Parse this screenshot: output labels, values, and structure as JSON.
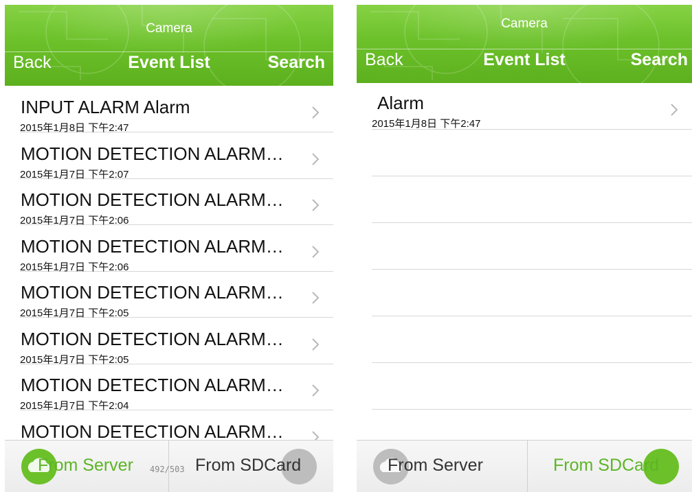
{
  "left": {
    "header": {
      "app_title": "Camera",
      "back_label": "Back",
      "title": "Event List",
      "search_label": "Search"
    },
    "events": [
      {
        "title": "INPUT ALARM Alarm",
        "date": "2015年1月8日 下午2:47"
      },
      {
        "title": "MOTION DETECTION ALARM…",
        "date": "2015年1月7日 下午2:07"
      },
      {
        "title": "MOTION DETECTION ALARM…",
        "date": "2015年1月7日 下午2:06"
      },
      {
        "title": "MOTION DETECTION ALARM…",
        "date": "2015年1月7日 下午2:06"
      },
      {
        "title": "MOTION DETECTION ALARM…",
        "date": "2015年1月7日 下午2:05"
      },
      {
        "title": "MOTION DETECTION ALARM…",
        "date": "2015年1月7日 下午2:05"
      },
      {
        "title": "MOTION DETECTION ALARM…",
        "date": "2015年1月7日 下午2:04"
      },
      {
        "title": "MOTION DETECTION ALARM…",
        "date": ""
      }
    ],
    "tabs": {
      "server_label": "From Server",
      "sdcard_label": "From SDCard",
      "active": "server"
    },
    "page_counter": "492/503"
  },
  "right": {
    "header": {
      "app_title": "Camera",
      "back_label": "Back",
      "title": "Event List",
      "search_label": "Search"
    },
    "events": [
      {
        "title": "Alarm",
        "date": "2015年1月8日 下午2:47"
      }
    ],
    "tabs": {
      "server_label": "From Server",
      "sdcard_label": "From SDCard",
      "active": "sdcard"
    }
  },
  "colors": {
    "accent": "#6cc12a",
    "active_tab_text": "#5cb525",
    "inactive_tab_text": "#333333",
    "inactive_icon": "#bdbdbd"
  },
  "icons": {
    "chevron": "chevron-right-icon",
    "cloud": "cloud-icon",
    "sdcard": "sdcard-icon"
  }
}
